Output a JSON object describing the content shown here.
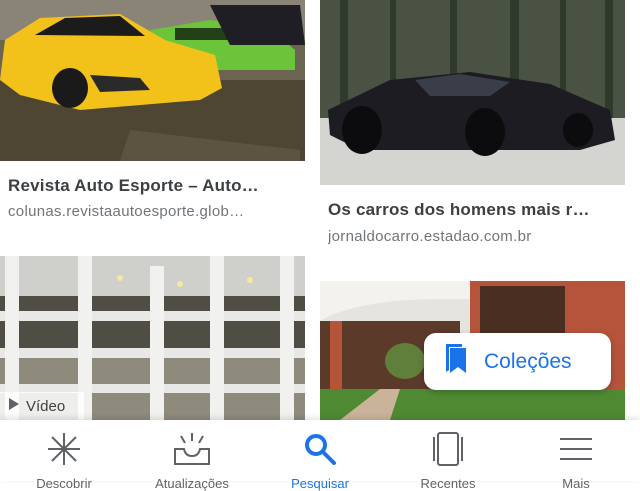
{
  "results": [
    {
      "title": "Revista Auto Esporte – Auto…",
      "source": "colunas.revistaautoesporte.glob…"
    },
    {
      "title": "Os carros dos homens mais r…",
      "source": "jornaldocarro.estadao.com.br"
    }
  ],
  "video_badge": {
    "label": "Vídeo",
    "icon": "play-icon"
  },
  "collections_button": {
    "label": "Coleções",
    "icon": "bookmark-icon"
  },
  "bottom_nav": [
    {
      "label": "Descobrir",
      "icon": "sparkle-icon",
      "active": false
    },
    {
      "label": "Atualizações",
      "icon": "inbox-icon",
      "active": false
    },
    {
      "label": "Pesquisar",
      "icon": "search-icon",
      "active": true
    },
    {
      "label": "Recentes",
      "icon": "tabs-icon",
      "active": false
    },
    {
      "label": "Mais",
      "icon": "menu-icon",
      "active": false
    }
  ],
  "colors": {
    "accent": "#1a73e8",
    "text": "#3c4043",
    "secondary": "#70757a"
  }
}
